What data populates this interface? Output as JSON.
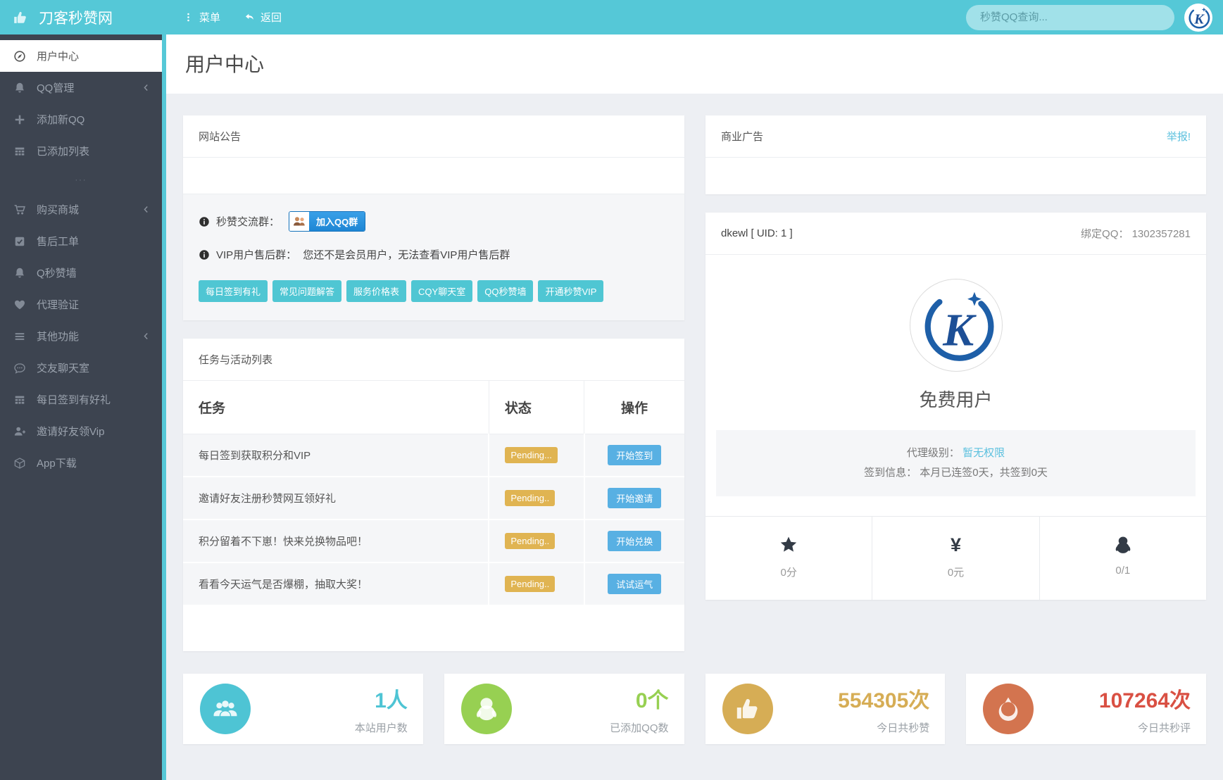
{
  "header": {
    "brand": "刀客秒赞网",
    "menu_label": "菜单",
    "back_label": "返回",
    "search_placeholder": "秒赞QQ查询...",
    "accent_color": "#55c8d7"
  },
  "sidebar": {
    "items": [
      {
        "label": "用户中心",
        "icon": "compass-icon",
        "active": true
      },
      {
        "label": "QQ管理",
        "icon": "bell-icon",
        "chevron": true
      },
      {
        "label": "添加新QQ",
        "icon": "plus-icon"
      },
      {
        "label": "已添加列表",
        "icon": "table-icon"
      },
      {
        "type": "separator",
        "label": "···"
      },
      {
        "label": "购买商城",
        "icon": "cart-icon",
        "chevron": true
      },
      {
        "label": "售后工单",
        "icon": "check-square-icon"
      },
      {
        "label": "Q秒赞墙",
        "icon": "bell-icon"
      },
      {
        "label": "代理验证",
        "icon": "heart-icon"
      },
      {
        "label": "其他功能",
        "icon": "bars-icon",
        "chevron": true
      },
      {
        "label": "交友聊天室",
        "icon": "comment-icon"
      },
      {
        "label": "每日签到有好礼",
        "icon": "table-icon"
      },
      {
        "label": "邀请好友领Vip",
        "icon": "user-plus-icon"
      },
      {
        "label": "App下载",
        "icon": "cube-icon"
      }
    ]
  },
  "page": {
    "title": "用户中心"
  },
  "announcement": {
    "title": "网站公告",
    "group_line_label": "秒赞交流群：",
    "join_button": "加入QQ群",
    "vip_line_label": "VIP用户售后群：",
    "vip_line_text": "您还不是会员用户，无法查看VIP用户售后群",
    "quick_links": [
      "每日签到有礼",
      "常见问题解答",
      "服务价格表",
      "CQY聊天室",
      "QQ秒赞墙",
      "开通秒赞VIP"
    ]
  },
  "ad_panel": {
    "title": "商业广告",
    "report_link": "举报!"
  },
  "tasks": {
    "title": "任务与活动列表",
    "columns": [
      "任务",
      "状态",
      "操作"
    ],
    "status_color": "#e0b452",
    "action_color": "#58b0e3",
    "rows": [
      {
        "task": "每日签到获取积分和VIP",
        "status": "Pending...",
        "action": "开始签到"
      },
      {
        "task": "邀请好友注册秒赞网互领好礼",
        "status": "Pending..",
        "action": "开始邀请"
      },
      {
        "task": "积分留着不下崽！快来兑换物品吧！",
        "status": "Pending..",
        "action": "开始兑换"
      },
      {
        "task": "看看今天运气是否爆棚，抽取大奖！",
        "status": "Pending..",
        "action": "试试运气"
      }
    ]
  },
  "profile": {
    "username": "dkewl [ UID: 1 ]",
    "bind_qq_label": "绑定QQ：",
    "bind_qq": "1302357281",
    "user_type": "免费用户",
    "agent_label": "代理级别：",
    "agent_value": "暂无权限",
    "signin_label": "签到信息：",
    "signin_value": "本月已连签0天，共签到0天",
    "link_color": "#5bc0de",
    "stats": [
      {
        "icon": "star-icon",
        "value": "0分"
      },
      {
        "icon": "yen-icon",
        "value": "0元"
      },
      {
        "icon": "penguin-icon",
        "value": "0/1"
      }
    ]
  },
  "summary_cards": [
    {
      "icon": "users-icon",
      "color": "#4ec4d4",
      "value": "1人",
      "label": "本站用户数"
    },
    {
      "icon": "penguin-icon",
      "color": "#97d052",
      "value": "0个",
      "label": "已添加QQ数"
    },
    {
      "icon": "thumb-icon",
      "color": "#d6ad55",
      "value": "554305次",
      "label": "今日共秒赞"
    },
    {
      "icon": "rebel-icon",
      "color": "#d3744f",
      "value": "107264次",
      "label": "今日共秒评",
      "value_color": "#d95043"
    }
  ]
}
